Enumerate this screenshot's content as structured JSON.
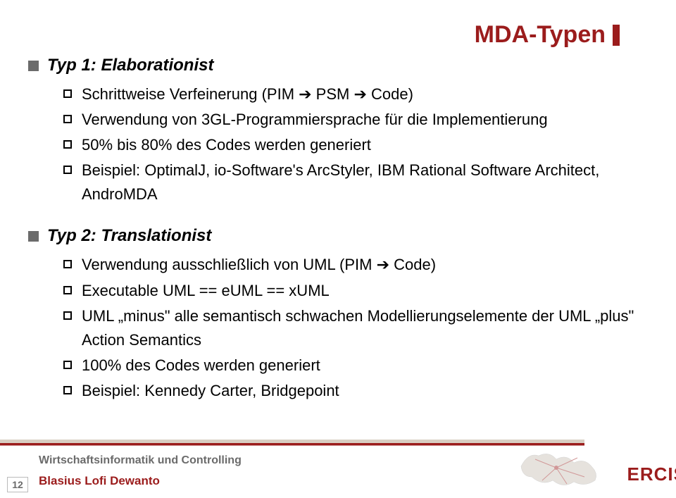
{
  "slide": {
    "title": "MDA-Typen"
  },
  "section1": {
    "heading": "Typ 1: Elaborationist",
    "items": [
      "Schrittweise Verfeinerung (PIM ➔ PSM ➔ Code)",
      "Verwendung von 3GL-Programmiersprache für die Implementierung",
      "50% bis 80% des Codes werden generiert",
      "Beispiel: OptimalJ, io-Software's ArcStyler, IBM Rational Software Architect, AndroMDA"
    ]
  },
  "section2": {
    "heading": "Typ 2: Translationist",
    "items": [
      "Verwendung ausschließlich von UML (PIM ➔ Code)",
      "Executable UML == eUML == xUML",
      "UML „minus\" alle semantisch schwachen Modellierungselemente der UML „plus\" Action Semantics",
      "100% des Codes werden generiert",
      "Beispiel: Kennedy Carter, Bridgepoint"
    ]
  },
  "footer": {
    "department": "Wirtschaftsinformatik und Controlling",
    "author": "Blasius Lofi Dewanto",
    "page": "12",
    "logo": "ERCIS"
  }
}
